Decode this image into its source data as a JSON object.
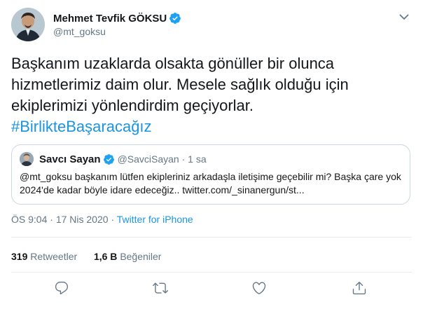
{
  "author": {
    "name": "Mehmet Tevfik GÖKSU",
    "handle": "@mt_goksu"
  },
  "tweet": {
    "text": "Başkanım uzaklarda olsakta gönüller bir olunca hizmetlerimiz daim olur. Mesele sağlık olduğu için ekiplerimizi yönlendirdim geçiyorlar.",
    "hashtag": "#BirlikteBaşaracağız"
  },
  "quote": {
    "name": "Savcı Sayan",
    "handle": "@SavciSayan",
    "separator": "·",
    "time": "1 sa",
    "text": "@mt_goksu başkanım lütfen ekipleriniz arkadaşla iletişime geçebilir mi? Başka çare yok 2024'de kadar böyle idare edeceğiz.. twitter.com/_sinanergun/st..."
  },
  "meta": {
    "time": "ÖS 9:04",
    "separator": "·",
    "date": "17 Nis 2020",
    "source": "Twitter for iPhone"
  },
  "stats": {
    "retweets_count": "319",
    "retweets_label": "Retweetler",
    "likes_count": "1,6 B",
    "likes_label": "Beğeniler"
  },
  "colors": {
    "accent": "#1b95e0",
    "verified": "#1da1f2",
    "secondary_text": "#657786",
    "border": "#ccd6dd"
  },
  "icons": [
    "verified-badge-icon",
    "chevron-down-icon",
    "reply-icon",
    "retweet-icon",
    "like-icon",
    "share-icon"
  ]
}
